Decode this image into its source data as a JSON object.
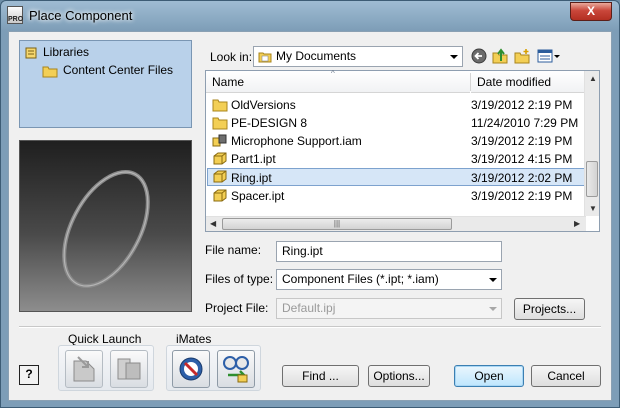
{
  "window": {
    "title": "Place Component",
    "app_icon_text": "PRO",
    "close_glyph": "X"
  },
  "libraries": {
    "items": [
      {
        "label": "Libraries",
        "icon": "libraries-icon"
      },
      {
        "label": "Content Center Files",
        "icon": "folder-icon"
      }
    ]
  },
  "look_in": {
    "label": "Look in:",
    "value": "My Documents"
  },
  "file_list": {
    "columns": [
      "Name",
      "Date modified"
    ],
    "rows": [
      {
        "name": "OldVersions",
        "date": "3/19/2012 2:19 PM",
        "icon": "folder-icon"
      },
      {
        "name": "PE-DESIGN 8",
        "date": "11/24/2010 7:29 PM",
        "icon": "folder-icon"
      },
      {
        "name": "Microphone Support.iam",
        "date": "3/19/2012 2:19 PM",
        "icon": "assembly-icon"
      },
      {
        "name": "Part1.ipt",
        "date": "3/19/2012 4:15 PM",
        "icon": "part-icon"
      },
      {
        "name": "Ring.ipt",
        "date": "3/19/2012 2:02 PM",
        "icon": "part-icon",
        "selected": true
      },
      {
        "name": "Spacer.ipt",
        "date": "3/19/2012 2:19 PM",
        "icon": "part-icon"
      }
    ]
  },
  "form": {
    "file_name_label": "File name:",
    "file_name_value": "Ring.ipt",
    "files_of_type_label": "Files of type:",
    "files_of_type_value": "Component Files (*.ipt; *.iam)",
    "project_file_label": "Project File:",
    "project_file_value": "Default.ipj",
    "projects_button": "Projects..."
  },
  "quick_launch": {
    "label": "Quick Launch"
  },
  "imates": {
    "label": "iMates"
  },
  "buttons": {
    "help": "?",
    "find": "Find ...",
    "options": "Options...",
    "open": "Open",
    "cancel": "Cancel"
  }
}
